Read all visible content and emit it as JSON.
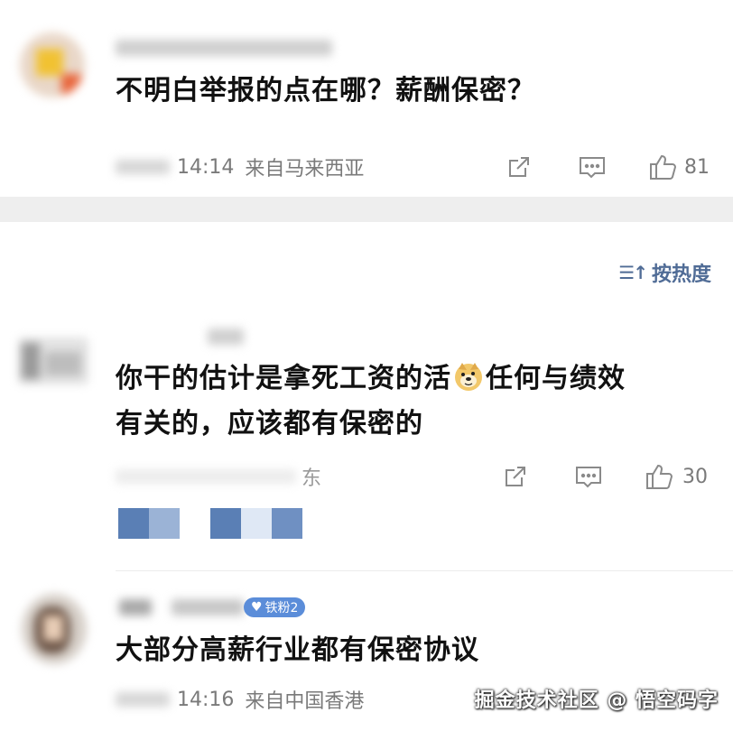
{
  "comments": [
    {
      "text": "不明白举报的点在哪？薪酬保密？",
      "time": "14:14",
      "location": "来自马来西亚",
      "likes": "81"
    },
    {
      "text_line1_a": "你干的估计是拿死工资的活",
      "text_line1_b": "任何与绩效",
      "text_line2": "有关的，应该都有保密的",
      "meta_partial": "东",
      "likes": "30"
    },
    {
      "badge": "铁粉2",
      "text": "大部分高薪行业都有保密协议",
      "time": "14:16",
      "location": "来自中国香港"
    }
  ],
  "sort": {
    "icon": "sort-icon",
    "label": "按热度"
  },
  "watermark": "掘金技术社区 @ 悟空码字",
  "icons": [
    "share-icon",
    "comment-icon",
    "like-icon",
    "doge-emoji-icon"
  ],
  "colors": {
    "accent": "#506c96",
    "badge": "#5b8dd9",
    "meta_text": "#7a7a7a",
    "divider": "#eeeeee"
  }
}
